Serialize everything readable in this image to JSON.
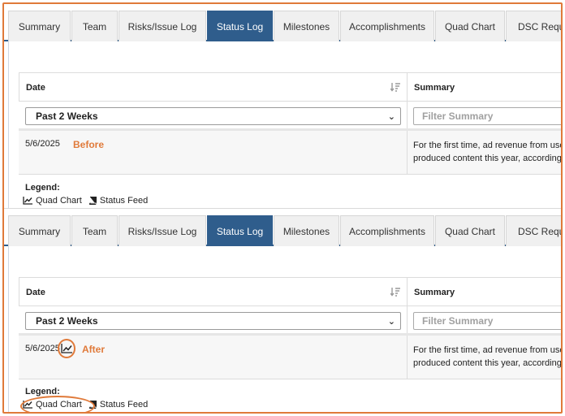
{
  "tabs": [
    "Summary",
    "Team",
    "Risks/Issue Log",
    "Status Log",
    "Milestones",
    "Accomplishments",
    "Quad Chart",
    "DSC Requ"
  ],
  "active_tab": "Status Log",
  "table": {
    "date_header": "Date",
    "summary_header": "Summary",
    "date_filter": "Past 2 Weeks",
    "summary_filter_placeholder": "Filter Summary"
  },
  "row": {
    "date": "5/6/2025",
    "summary_line1": "For the first time, ad revenue from user",
    "summary_line2": "produced content this year, according t"
  },
  "legend": {
    "title": "Legend:",
    "quad_chart": "Quad Chart",
    "status_feed": "Status Feed"
  },
  "annotations": {
    "before": "Before",
    "after": "After"
  },
  "colors": {
    "active_tab": "#2f5d8c",
    "annotation": "#e07a3a"
  },
  "icons": {
    "sort": "sort-descending-icon",
    "quad_chart": "line-chart-icon",
    "status_feed": "book-icon"
  }
}
